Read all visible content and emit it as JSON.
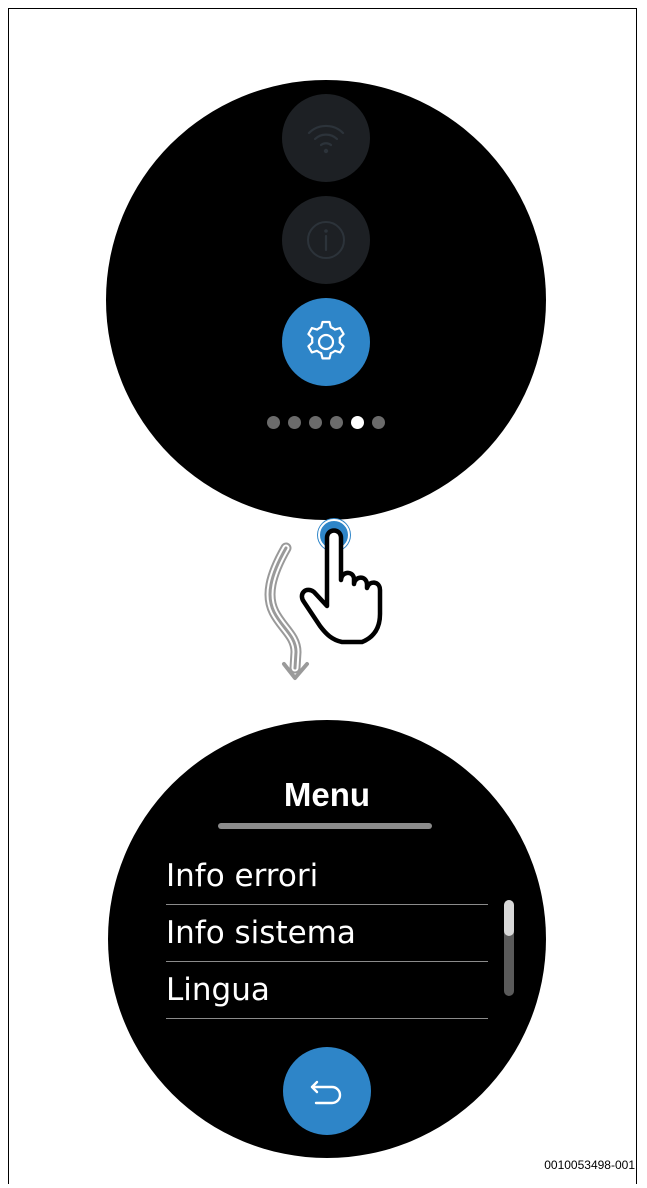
{
  "top_screen": {
    "icons": [
      "wifi-icon",
      "info-icon",
      "gear-icon"
    ],
    "page_indicator": {
      "total": 6,
      "active_index": 4
    }
  },
  "gesture": {
    "description_icons": [
      "swipe-down-arrow-icon",
      "hand-pointer-icon"
    ]
  },
  "bottom_screen": {
    "title": "Menu",
    "items": [
      {
        "label": "Info errori"
      },
      {
        "label": "Info sistema"
      },
      {
        "label": "Lingua"
      }
    ],
    "back_icon": "return-arrow-icon"
  },
  "caption": "0010053498-001",
  "colors": {
    "accent": "#2e85c8",
    "screen_bg": "#000000",
    "dim_button": "#1d2024",
    "divider": "#8b8b8b"
  }
}
